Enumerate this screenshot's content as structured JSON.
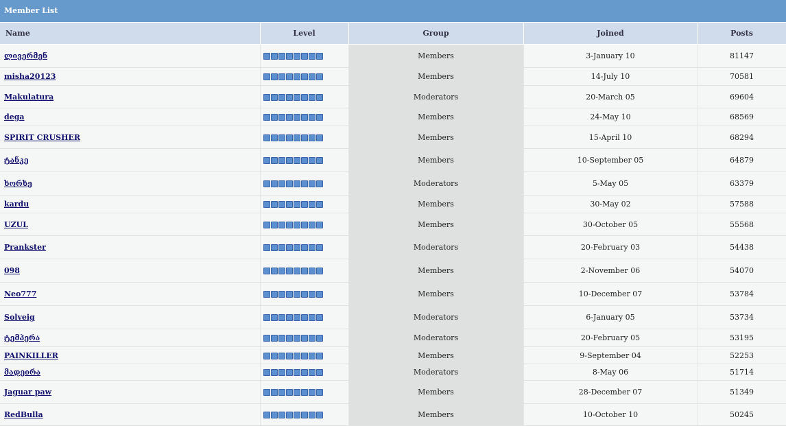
{
  "title": "Member List",
  "columns": {
    "name": "Name",
    "level": "Level",
    "group": "Group",
    "joined": "Joined",
    "posts": "Posts"
  },
  "level_pips": 8,
  "members": [
    {
      "name": "ლივერმენ",
      "group": "Members",
      "joined": "3-January 10",
      "posts": "81147",
      "h": 34
    },
    {
      "name": "misha20123",
      "group": "Members",
      "joined": "14-July 10",
      "posts": "70581",
      "h": 26
    },
    {
      "name": "Makulatura",
      "group": "Moderators",
      "joined": "20-March 05",
      "posts": "69604",
      "h": 33
    },
    {
      "name": "dega",
      "group": "Members",
      "joined": "24-May 10",
      "posts": "68569",
      "h": 26
    },
    {
      "name": "SPIRIT CRUSHER",
      "group": "Members",
      "joined": "15-April 10",
      "posts": "68294",
      "h": 33
    },
    {
      "name": "ტანკე",
      "group": "Members",
      "joined": "10-September 05",
      "posts": "64879",
      "h": 34
    },
    {
      "name": "ხორხე",
      "group": "Moderators",
      "joined": "5-May 05",
      "posts": "63379",
      "h": 34
    },
    {
      "name": "kardu",
      "group": "Members",
      "joined": "30-May 02",
      "posts": "57588",
      "h": 26
    },
    {
      "name": "UZUL",
      "group": "Members",
      "joined": "30-October 05",
      "posts": "55568",
      "h": 33
    },
    {
      "name": "Prankster",
      "group": "Moderators",
      "joined": "20-February 03",
      "posts": "54438",
      "h": 34
    },
    {
      "name": "098",
      "group": "Members",
      "joined": "2-November 06",
      "posts": "54070",
      "h": 34
    },
    {
      "name": "Neo777",
      "group": "Members",
      "joined": "10-December 07",
      "posts": "53784",
      "h": 34
    },
    {
      "name": "Solveig",
      "group": "Moderators",
      "joined": "6-January 05",
      "posts": "53734",
      "h": 34
    },
    {
      "name": "ტემპერა",
      "group": "Moderators",
      "joined": "20-February 05",
      "posts": "53195",
      "h": 26
    },
    {
      "name": "PAINKILLER",
      "group": "Members",
      "joined": "9-September 04",
      "posts": "52253",
      "h": 25
    },
    {
      "name": "მადეირა",
      "group": "Moderators",
      "joined": "8-May 06",
      "posts": "51714",
      "h": 24
    },
    {
      "name": "Jaguar paw",
      "group": "Members",
      "joined": "28-December 07",
      "posts": "51349",
      "h": 34
    },
    {
      "name": "RedBulla",
      "group": "Members",
      "joined": "10-October 10",
      "posts": "50245",
      "h": 32
    }
  ]
}
